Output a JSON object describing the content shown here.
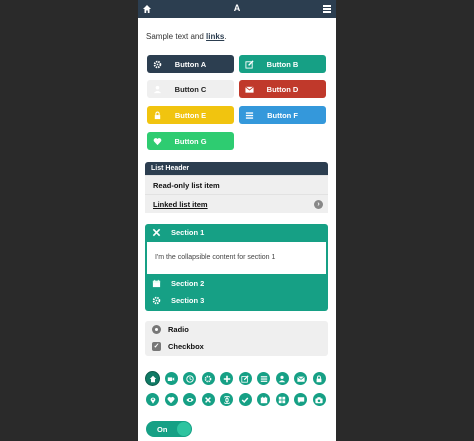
{
  "header": {
    "title": "A",
    "home_icon": "home-icon",
    "menu_icon": "hamburger-icon"
  },
  "sample": {
    "text": "Sample text and ",
    "link": "links",
    "suffix": "."
  },
  "buttons": [
    {
      "label": "Button A",
      "icon": "gear-icon",
      "color": "#2c3e50"
    },
    {
      "label": "Button B",
      "icon": "edit-icon",
      "color": "#16a085"
    },
    {
      "label": "Button C",
      "icon": "user-icon",
      "color": "#efefef"
    },
    {
      "label": "Button D",
      "icon": "mail-icon",
      "color": "#c0392b"
    },
    {
      "label": "Button E",
      "icon": "lock-icon",
      "color": "#f1c40f"
    },
    {
      "label": "Button F",
      "icon": "list-icon",
      "color": "#3498db"
    },
    {
      "label": "Button G",
      "icon": "heart-icon",
      "color": "#2ecc71"
    }
  ],
  "list": {
    "header": "List Header",
    "items": [
      {
        "label": "Read-only list item"
      },
      {
        "label": "Linked list item"
      }
    ]
  },
  "collapsible": {
    "sections": [
      {
        "label": "Section 1",
        "icon": "close-icon",
        "content": "I'm the collapsible content for section 1"
      },
      {
        "label": "Section 2",
        "icon": "calendar-icon"
      },
      {
        "label": "Section 3",
        "icon": "gear-icon"
      }
    ]
  },
  "form": {
    "radio_label": "Radio",
    "checkbox_label": "Checkbox"
  },
  "icon_row_1": [
    "home-icon",
    "video-icon",
    "clock-icon",
    "gear-icon",
    "plus-icon",
    "edit-icon",
    "list-icon",
    "user-icon",
    "mail-icon",
    "lock-icon"
  ],
  "icon_row_2": [
    "location-icon",
    "heart-icon",
    "eye-icon",
    "close-icon",
    "command-icon",
    "check-icon",
    "calendar-icon",
    "grid-icon",
    "comment-icon",
    "camera-icon"
  ],
  "toggle": {
    "label": "On",
    "color": "#16a085"
  },
  "colors": {
    "accent": "#16a085",
    "header": "#2c3e50"
  }
}
